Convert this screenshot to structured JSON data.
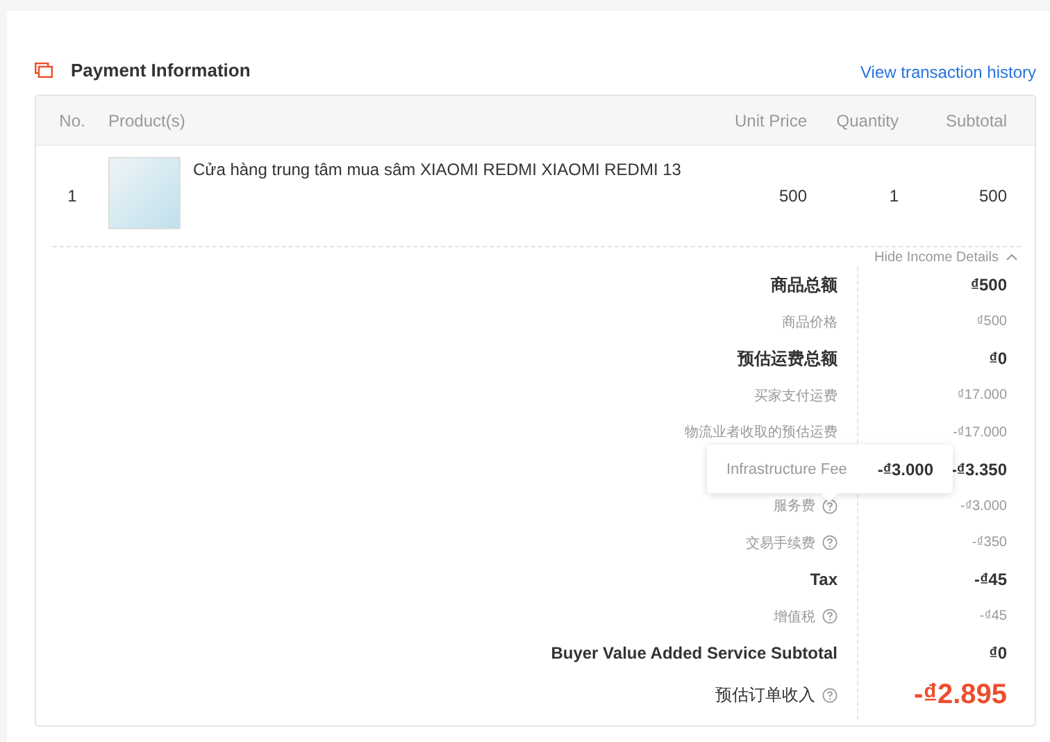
{
  "section": {
    "title": "Payment Information",
    "link": "View transaction history"
  },
  "table": {
    "columns": [
      "No.",
      "Product(s)",
      "Unit Price",
      "Quantity",
      "Subtotal"
    ],
    "rows": [
      {
        "no": "1",
        "product": "Cửa hàng trung tâm mua sâm XIAOMI REDMI XIAOMI REDMI 13",
        "unit_price": "500",
        "quantity": "1",
        "subtotal": "500"
      }
    ]
  },
  "income": {
    "toggle": "Hide Income Details",
    "expanded": true,
    "rows": [
      {
        "kind": "total",
        "label": "商品总额",
        "value": "₫500"
      },
      {
        "kind": "detail",
        "label": "商品价格",
        "value": "₫500"
      },
      {
        "kind": "total",
        "label": "预估运费总额",
        "value": "₫0"
      },
      {
        "kind": "detail",
        "label": "买家支付运费",
        "value": "₫17.000"
      },
      {
        "kind": "detail",
        "label": "物流业者收取的预估运费",
        "value": "-₫17.000"
      },
      {
        "kind": "total",
        "value": "-₫3.350"
      },
      {
        "kind": "detail",
        "label": "服务费",
        "help": true,
        "value": "-₫3.000"
      },
      {
        "kind": "detail",
        "label": "交易手续费",
        "help": true,
        "value": "-₫350"
      },
      {
        "kind": "total",
        "label": "Tax",
        "value": "-₫45"
      },
      {
        "kind": "detail",
        "label": "增值税",
        "help": true,
        "value": "-₫45"
      },
      {
        "kind": "total",
        "label": "Buyer Value Added Service Subtotal",
        "value": "₫0"
      },
      {
        "kind": "final",
        "label": "预估订单收入",
        "help": true,
        "value": "-₫2.895"
      }
    ],
    "tooltip": {
      "label": "Infrastructure Fee",
      "value": "-₫3.000"
    }
  }
}
